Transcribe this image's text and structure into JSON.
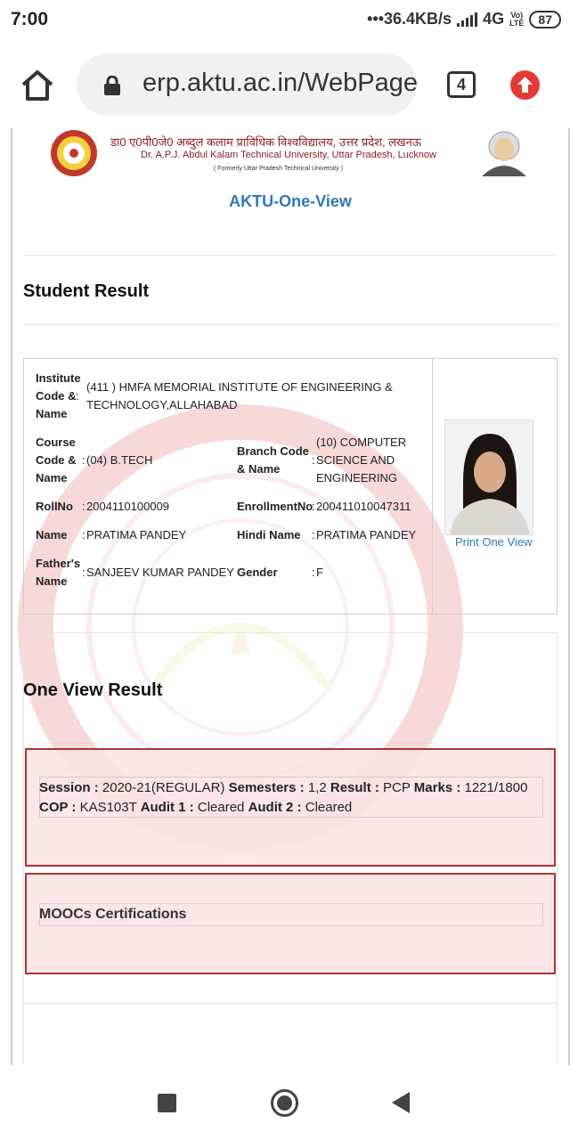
{
  "status_bar": {
    "time": "7:00",
    "network_speed": "•••36.4KB/s",
    "network_type": "4G",
    "volte": "Vo)\nLTE",
    "battery": "87"
  },
  "browser": {
    "url": "erp.aktu.ac.in/WebPage",
    "tab_count": "4",
    "update_color": "#e53935"
  },
  "header": {
    "hindi_name": "डा0 ए0पी0जे0 अब्दुल कलाम प्राविधिक विश्वविद्यालय, उत्तर प्रदेश, लखनऊ",
    "english_name": "Dr. A.P.J. Abdul Kalam Technical University, Uttar Pradesh, Lucknow",
    "formerly": "( Formerly Uttar Pradesh Technical University )",
    "app_title": "AKTU-One-View"
  },
  "student_result": {
    "title": "Student Result",
    "institute_label": "Institute\nCode &\nName",
    "institute_value": "(411 ) HMFA MEMORIAL INSTITUTE OF ENGINEERING &\nTECHNOLOGY,ALLAHABAD",
    "course_label": "Course\nCode &\nName",
    "course_value": "(04) B.TECH",
    "branch_label": "Branch Code\n& Name",
    "branch_value": "(10) COMPUTER\nSCIENCE AND\nENGINEERING",
    "rollno_label": "RollNo",
    "rollno_value": "2004110100009",
    "enrollment_label": "EnrollmentNo",
    "enrollment_value": "200411010047311",
    "name_label": "Name",
    "name_value": "PRATIMA PANDEY",
    "hindi_name_label": "Hindi Name",
    "hindi_name_value": "PRATIMA PANDEY",
    "father_label": "Father's\nName",
    "father_value": "SANJEEV KUMAR PANDEY",
    "gender_label": "Gender",
    "gender_value": "F",
    "print_link": "Print One View"
  },
  "one_view": {
    "title": "One View Result",
    "session_label": "Session :",
    "session_value": "2020-21(REGULAR)",
    "semesters_label": "Semesters :",
    "semesters_value": "1,2",
    "result_label": "Result :",
    "result_value": "PCP",
    "marks_label": "Marks :",
    "marks_value": "1221/1800",
    "cop_label": "COP :",
    "cop_value": "KAS103T",
    "audit1_label": "Audit 1 :",
    "audit1_value": "Cleared",
    "audit2_label": "Audit 2 :",
    "audit2_value": "Cleared",
    "moocs_title": "MOOCs Certifications"
  }
}
